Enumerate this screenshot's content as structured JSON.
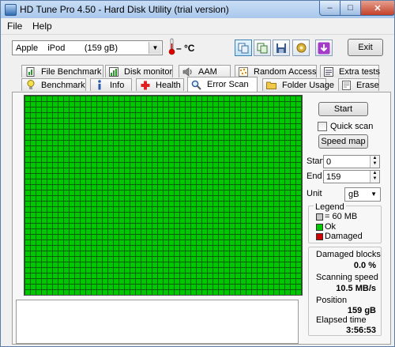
{
  "window": {
    "title": "HD Tune Pro 4.50 - Hard Disk Utility (trial version)",
    "minimize": "–",
    "maximize": "□",
    "close": "✕"
  },
  "menu": [
    "File",
    "Help"
  ],
  "toolbar": {
    "drive": "Apple    iPod        (159 gB)",
    "temperature": "– °C",
    "buttons": [
      "copy-text-icon",
      "copy-screenshot-icon",
      "save-icon",
      "options-icon",
      "download-icon"
    ],
    "exit_label": "Exit"
  },
  "tabs_row1": [
    {
      "label": "File Benchmark",
      "icon": "file-benchmark-icon"
    },
    {
      "label": "Disk monitor",
      "icon": "disk-monitor-icon"
    },
    {
      "label": "AAM",
      "icon": "speaker-icon"
    },
    {
      "label": "Random Access",
      "icon": "random-access-icon"
    },
    {
      "label": "Extra tests",
      "icon": "extra-tests-icon"
    }
  ],
  "tabs_row2": [
    {
      "label": "Benchmark",
      "icon": "benchmark-icon"
    },
    {
      "label": "Info",
      "icon": "info-icon"
    },
    {
      "label": "Health",
      "icon": "health-cross-icon"
    },
    {
      "label": "Error Scan",
      "icon": "magnifier-icon"
    },
    {
      "label": "Folder Usage",
      "icon": "folder-icon"
    },
    {
      "label": "Erase",
      "icon": "erase-icon"
    }
  ],
  "active_tab": "Error Scan",
  "error_scan": {
    "start_label": "Start",
    "quick_scan_label": "Quick scan",
    "quick_scan_checked": false,
    "speed_map_label": "Speed map",
    "start_field_label": "Start",
    "start_value": "0",
    "end_field_label": "End",
    "end_value": "159",
    "unit_label": "Unit",
    "unit_value": "gB",
    "legend": {
      "title": "Legend",
      "items": [
        {
          "label": "= 60 MB",
          "color": "#c8c8c8"
        },
        {
          "label": "Ok",
          "color": "#00c800"
        },
        {
          "label": "Damaged",
          "color": "#d00000"
        }
      ]
    },
    "stats": {
      "damaged_label": "Damaged blocks",
      "damaged_value": "0.0 %",
      "speed_label": "Scanning speed",
      "speed_value": "10.5 MB/s",
      "position_label": "Position",
      "position_value": "159 gB",
      "elapsed_label": "Elapsed time",
      "elapsed_value": "3:56:53"
    }
  },
  "colors": {
    "ok_block": "#00c800",
    "grid_line": "#0a5f0a",
    "damaged": "#d00000"
  }
}
